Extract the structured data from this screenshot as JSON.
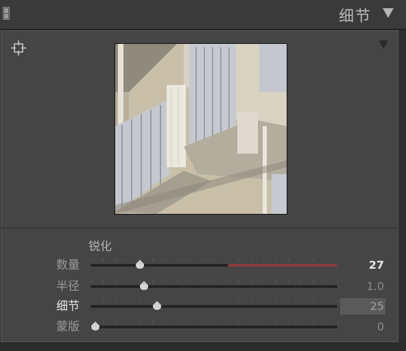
{
  "header": {
    "title": "细节"
  },
  "preview": {
    "description_icon": "crosshair-target-icon"
  },
  "sharpening": {
    "section_label": "锐化",
    "sliders": [
      {
        "label": "数量",
        "value": "27",
        "fraction": 0.2,
        "active": false
      },
      {
        "label": "半径",
        "value": "1.0",
        "fraction": 0.218,
        "active": false
      },
      {
        "label": "细节",
        "value": "25",
        "fraction": 0.27,
        "active": true
      },
      {
        "label": "蒙版",
        "value": "0",
        "fraction": 0.02,
        "active": false
      }
    ]
  },
  "colors": {
    "accent_red": "#8a3a3a",
    "panel_bg": "#454545",
    "header_bg": "#3a3a3a"
  }
}
